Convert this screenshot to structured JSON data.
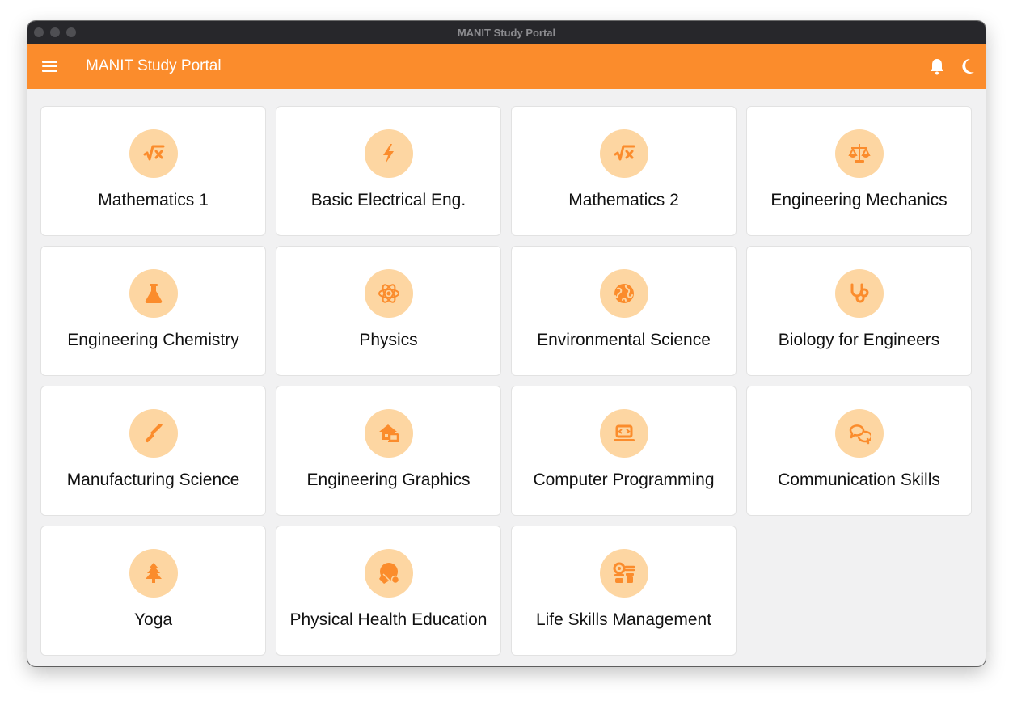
{
  "window": {
    "title": "MANIT Study Portal"
  },
  "appbar": {
    "title": "MANIT Study Portal"
  },
  "theme": {
    "accent": "#fb8c2c",
    "icon_bg": "#fdd6a2",
    "icon_color": "#fb8c2c"
  },
  "subjects": [
    {
      "label": "Mathematics 1",
      "icon": "square-root-icon"
    },
    {
      "label": "Basic Electrical Eng.",
      "icon": "bolt-icon"
    },
    {
      "label": "Mathematics 2",
      "icon": "square-root-icon"
    },
    {
      "label": "Engineering Mechanics",
      "icon": "scale-icon"
    },
    {
      "label": "Engineering Chemistry",
      "icon": "flask-icon"
    },
    {
      "label": "Physics",
      "icon": "atom-icon"
    },
    {
      "label": "Environmental Science",
      "icon": "globe-icon"
    },
    {
      "label": "Biology for Engineers",
      "icon": "stethoscope-icon"
    },
    {
      "label": "Manufacturing Science",
      "icon": "screwdriver-icon"
    },
    {
      "label": "Engineering Graphics",
      "icon": "house-laptop-icon"
    },
    {
      "label": "Computer Programming",
      "icon": "laptop-code-icon"
    },
    {
      "label": "Communication Skills",
      "icon": "chat-bubbles-icon"
    },
    {
      "label": "Yoga",
      "icon": "tree-icon"
    },
    {
      "label": "Physical Health Education",
      "icon": "table-tennis-icon"
    },
    {
      "label": "Life Skills Management",
      "icon": "people-roof-icon"
    }
  ]
}
